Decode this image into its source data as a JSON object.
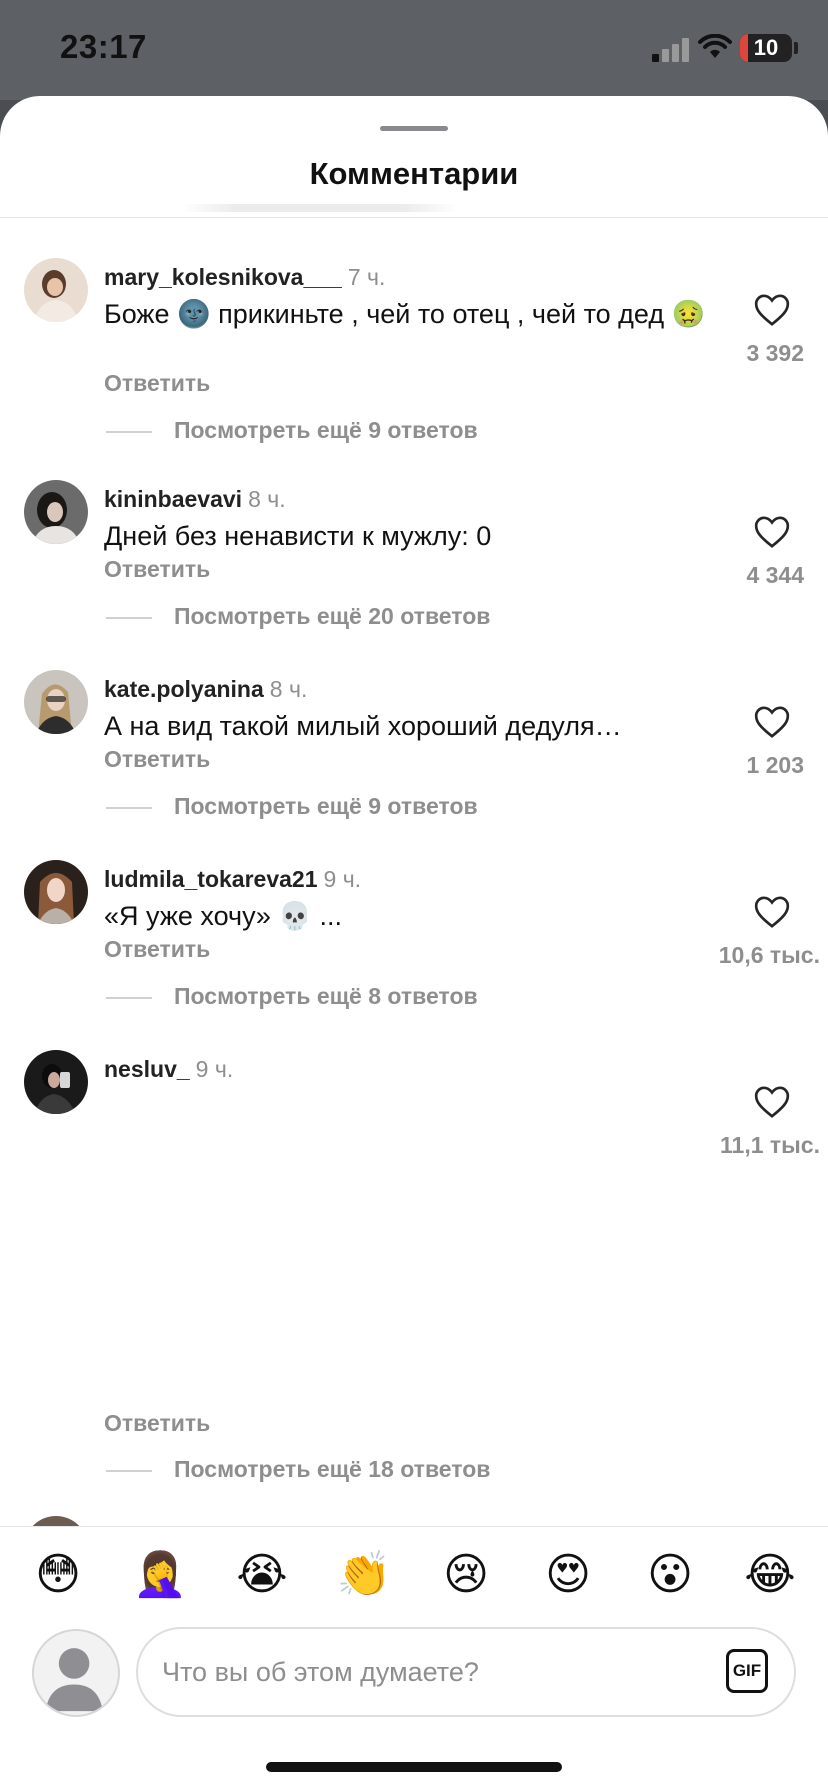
{
  "status": {
    "time": "23:17",
    "battery": "10"
  },
  "sheet": {
    "title": "Комментарии"
  },
  "comments": [
    {
      "username": "mary_kolesnikova___",
      "time": "7 ч.",
      "text": "Боже 🌚 прикиньте , чей то отец , чей то дед 🤢",
      "reply": "Ответить",
      "more": "Посмотреть ещё 9 ответов",
      "likes": "3 392"
    },
    {
      "username": "kininbaevavi",
      "time": "8 ч.",
      "text": "Дней без ненависти к мужлу: 0",
      "reply": "Ответить",
      "more": "Посмотреть ещё 20 ответов",
      "likes": "4 344"
    },
    {
      "username": "kate.polyanina",
      "time": "8 ч.",
      "text": "А на вид такой милый хороший дедуля…",
      "reply": "Ответить",
      "more": "Посмотреть ещё 9 ответов",
      "likes": "1 203"
    },
    {
      "username": "ludmila_tokareva21",
      "time": "9 ч.",
      "text": "«Я уже хочу» 💀 ...",
      "reply": "Ответить",
      "more": "Посмотреть ещё 8 ответов",
      "likes": "10,6 тыс."
    },
    {
      "username": "nesluv_",
      "time": "9 ч.",
      "text": "",
      "reply": "Ответить",
      "more": "Посмотреть ещё 18 ответов",
      "likes": "11,1 тыс."
    }
  ],
  "emoji_bar": [
    "😳",
    "🤦‍♀️",
    "😭",
    "👏",
    "😢",
    "😍",
    "😮",
    "😂"
  ],
  "composer": {
    "placeholder": "Что вы об этом думаете?",
    "gif_label": "GIF"
  },
  "icons": {
    "like": "heart-outline-icon",
    "gif": "gif-icon",
    "profile": "person-icon"
  }
}
